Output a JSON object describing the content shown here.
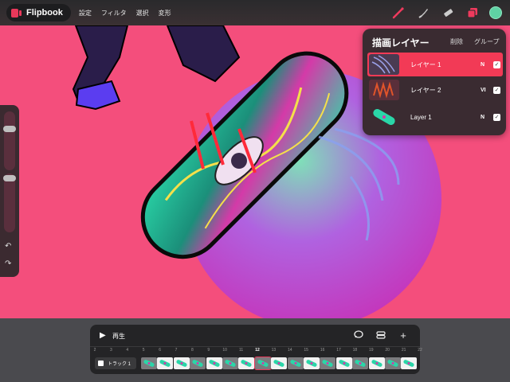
{
  "app": {
    "name": "Flipbook"
  },
  "menu": [
    {
      "label": "設定"
    },
    {
      "label": "フィルタ"
    },
    {
      "label": "選択"
    },
    {
      "label": "変形"
    }
  ],
  "tools": [
    {
      "icon": "brush-icon"
    },
    {
      "icon": "smudge-icon"
    },
    {
      "icon": "eraser-icon"
    },
    {
      "icon": "layers-icon"
    }
  ],
  "current_color": "#5fd2a4",
  "left_panel": {
    "brush_size": 0.85,
    "opacity": 0.4,
    "undo_icon": "undo-icon",
    "redo_icon": "redo-icon"
  },
  "layers_panel": {
    "title": "描画レイヤー",
    "delete_label": "削除",
    "group_label": "グループ",
    "layers": [
      {
        "name": "レイヤー 1",
        "mode": "N",
        "visible": true,
        "selected": true
      },
      {
        "name": "レイヤー 2",
        "mode": "VI",
        "visible": true,
        "selected": false
      },
      {
        "name": "Layer 1",
        "mode": "N",
        "visible": true,
        "selected": false
      }
    ]
  },
  "timeline": {
    "play_label": "再生",
    "icons": [
      "comment-icon",
      "stack-icon",
      "add-icon"
    ],
    "frame_numbers": [
      "2",
      "3",
      "4",
      "5",
      "6",
      "7",
      "8",
      "9",
      "10",
      "11",
      "12",
      "13",
      "14",
      "15",
      "16",
      "17",
      "18",
      "19",
      "20",
      "21",
      "22"
    ],
    "current_frame": "12",
    "track_name": "トラック 1"
  },
  "colors": {
    "accent": "#e8385a",
    "canvas_bg": "#f44e7c",
    "panel_bg": "#3a2b31",
    "selected_layer": "#f23a56"
  }
}
